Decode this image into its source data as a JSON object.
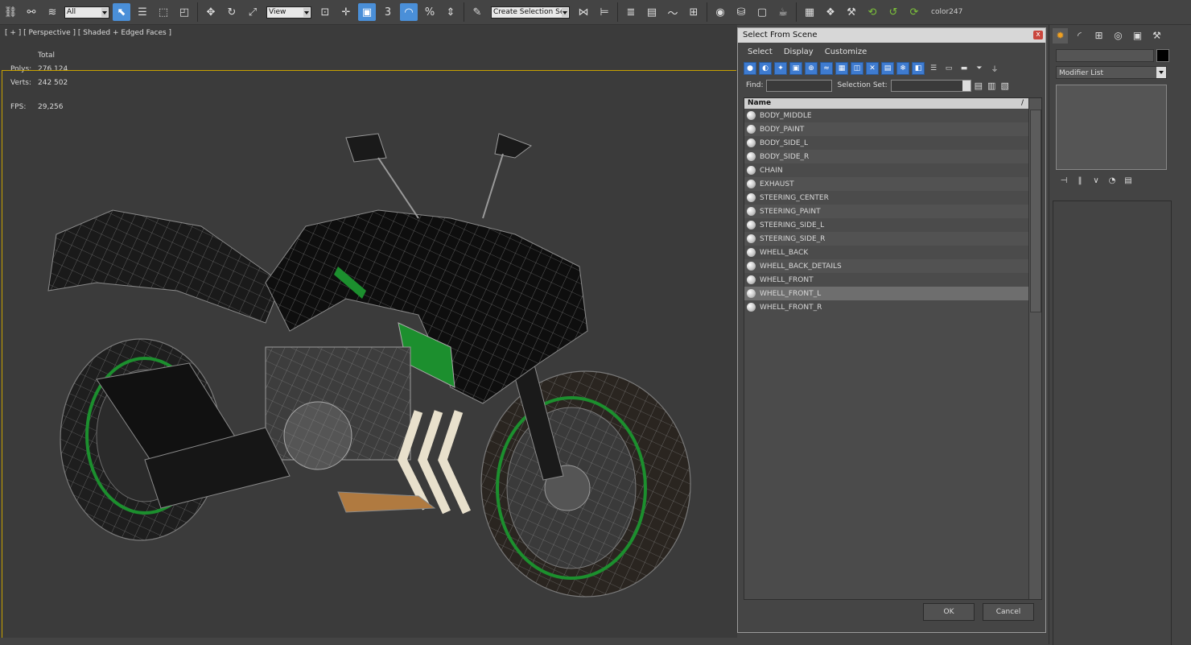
{
  "toolbar": {
    "selection_filter": "All",
    "reference_coord": "View",
    "named_selection_set": "Create Selection Se",
    "snap_3": "3",
    "snap_pct": "%",
    "color_label": "color247"
  },
  "viewport": {
    "label": "[ + ] [ Perspective ] [ Shaded + Edged Faces ]",
    "stats_header": "Total",
    "polys_label": "Polys:",
    "polys_value": "276 124",
    "verts_label": "Verts:",
    "verts_value": "242 502",
    "fps_label": "FPS:",
    "fps_value": "29,256"
  },
  "dialog": {
    "title": "Select From Scene",
    "close": "x",
    "menu": [
      "Select",
      "Display",
      "Customize"
    ],
    "find_label": "Find:",
    "find_value": "",
    "selection_set_label": "Selection Set:",
    "column_name": "Name",
    "sort_mark": "/",
    "items": [
      "BODY_MIDDLE",
      "BODY_PAINT",
      "BODY_SIDE_L",
      "BODY_SIDE_R",
      "CHAIN",
      "EXHAUST",
      "STEERING_CENTER",
      "STEERING_PAINT",
      "STEERING_SIDE_L",
      "STEERING_SIDE_R",
      "WHELL_BACK",
      "WHELL_BACK_DETAILS",
      "WHELL_FRONT",
      "WHELL_FRONT_L",
      "WHELL_FRONT_R"
    ],
    "selected_item": "WHELL_FRONT_L",
    "ok": "OK",
    "cancel": "Cancel"
  },
  "command_panel": {
    "modifier_list": "Modifier List"
  },
  "colors": {
    "accent_blue": "#4a8fd8",
    "viewport_border": "#c8a200",
    "stats_text": "#e3c23c",
    "bike_green": "#1c8f2e"
  }
}
